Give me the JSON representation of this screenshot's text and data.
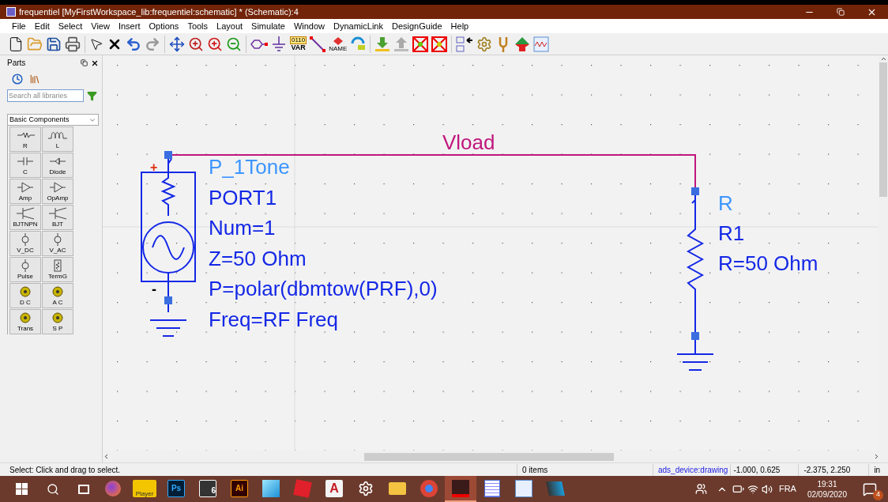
{
  "window": {
    "title": "frequentiel [MyFirstWorkspace_lib:frequentiel:schematic] * (Schematic):4"
  },
  "menu": [
    "File",
    "Edit",
    "Select",
    "View",
    "Insert",
    "Options",
    "Tools",
    "Layout",
    "Simulate",
    "Window",
    "DynamicLink",
    "DesignGuide",
    "Help"
  ],
  "toolbar": {
    "var_bits": "0110",
    "var_label": "VAR",
    "name_label": "NAME"
  },
  "parts_panel": {
    "title": "Parts",
    "search": {
      "placeholder": "Search all libraries"
    },
    "library": "Basic Components",
    "items": [
      {
        "label": "R",
        "kind": "resistor"
      },
      {
        "label": "L",
        "kind": "inductor"
      },
      {
        "label": "C",
        "kind": "capacitor"
      },
      {
        "label": "Diode",
        "kind": "diode"
      },
      {
        "label": "Amp",
        "kind": "amp"
      },
      {
        "label": "OpAmp",
        "kind": "amp"
      },
      {
        "label": "BJTNPN",
        "kind": "bjt"
      },
      {
        "label": "BJT",
        "kind": "bjt"
      },
      {
        "label": "V_DC",
        "kind": "source"
      },
      {
        "label": "V_AC",
        "kind": "source"
      },
      {
        "label": "Pulse",
        "kind": "source"
      },
      {
        "label": "TermG",
        "kind": "term"
      },
      {
        "label": "D C",
        "kind": "sim"
      },
      {
        "label": "A C",
        "kind": "sim"
      },
      {
        "label": "Trans",
        "kind": "sim"
      },
      {
        "label": "S P",
        "kind": "sim"
      }
    ]
  },
  "schematic": {
    "net_label": "Vload",
    "port": {
      "plus": "+",
      "minus": "-",
      "lines": [
        "P_1Tone",
        "PORT1",
        "Num=1",
        "Z=50 Ohm",
        "P=polar(dbmtow(PRF),0)",
        "Freq=RF Freq"
      ]
    },
    "resistor": {
      "lines": [
        "R",
        "R1",
        "R=50 Ohm"
      ]
    }
  },
  "status_bar": {
    "hint": "Select: Click and drag to select.",
    "count": "0 items",
    "layer": "ads_device:drawing",
    "coord_1": "-1.000, 0.625",
    "coord_2": "-2.375, 2.250",
    "units": "in"
  },
  "taskbar": {
    "apps": [
      {
        "kind": "firefox",
        "selected": false
      },
      {
        "kind": "player",
        "label": "Player",
        "selected": false
      },
      {
        "kind": "ps",
        "label": "Ps",
        "selected": false
      },
      {
        "kind": "plant",
        "label": "6",
        "selected": false
      },
      {
        "kind": "ai",
        "label": "Ai",
        "selected": false
      },
      {
        "kind": "blade",
        "selected": false
      },
      {
        "kind": "sketch",
        "selected": false
      },
      {
        "kind": "autocad",
        "label": "A",
        "selected": false
      },
      {
        "kind": "gear",
        "selected": false
      },
      {
        "kind": "folder",
        "selected": false
      },
      {
        "kind": "chrome",
        "selected": false
      },
      {
        "kind": "ads",
        "selected": true
      },
      {
        "kind": "list",
        "selected": false
      },
      {
        "kind": "wave",
        "selected": false
      },
      {
        "kind": "tool",
        "selected": false
      }
    ],
    "language": "FRA",
    "time": "19:31",
    "date": "02/09/2020",
    "notifications": "4"
  }
}
